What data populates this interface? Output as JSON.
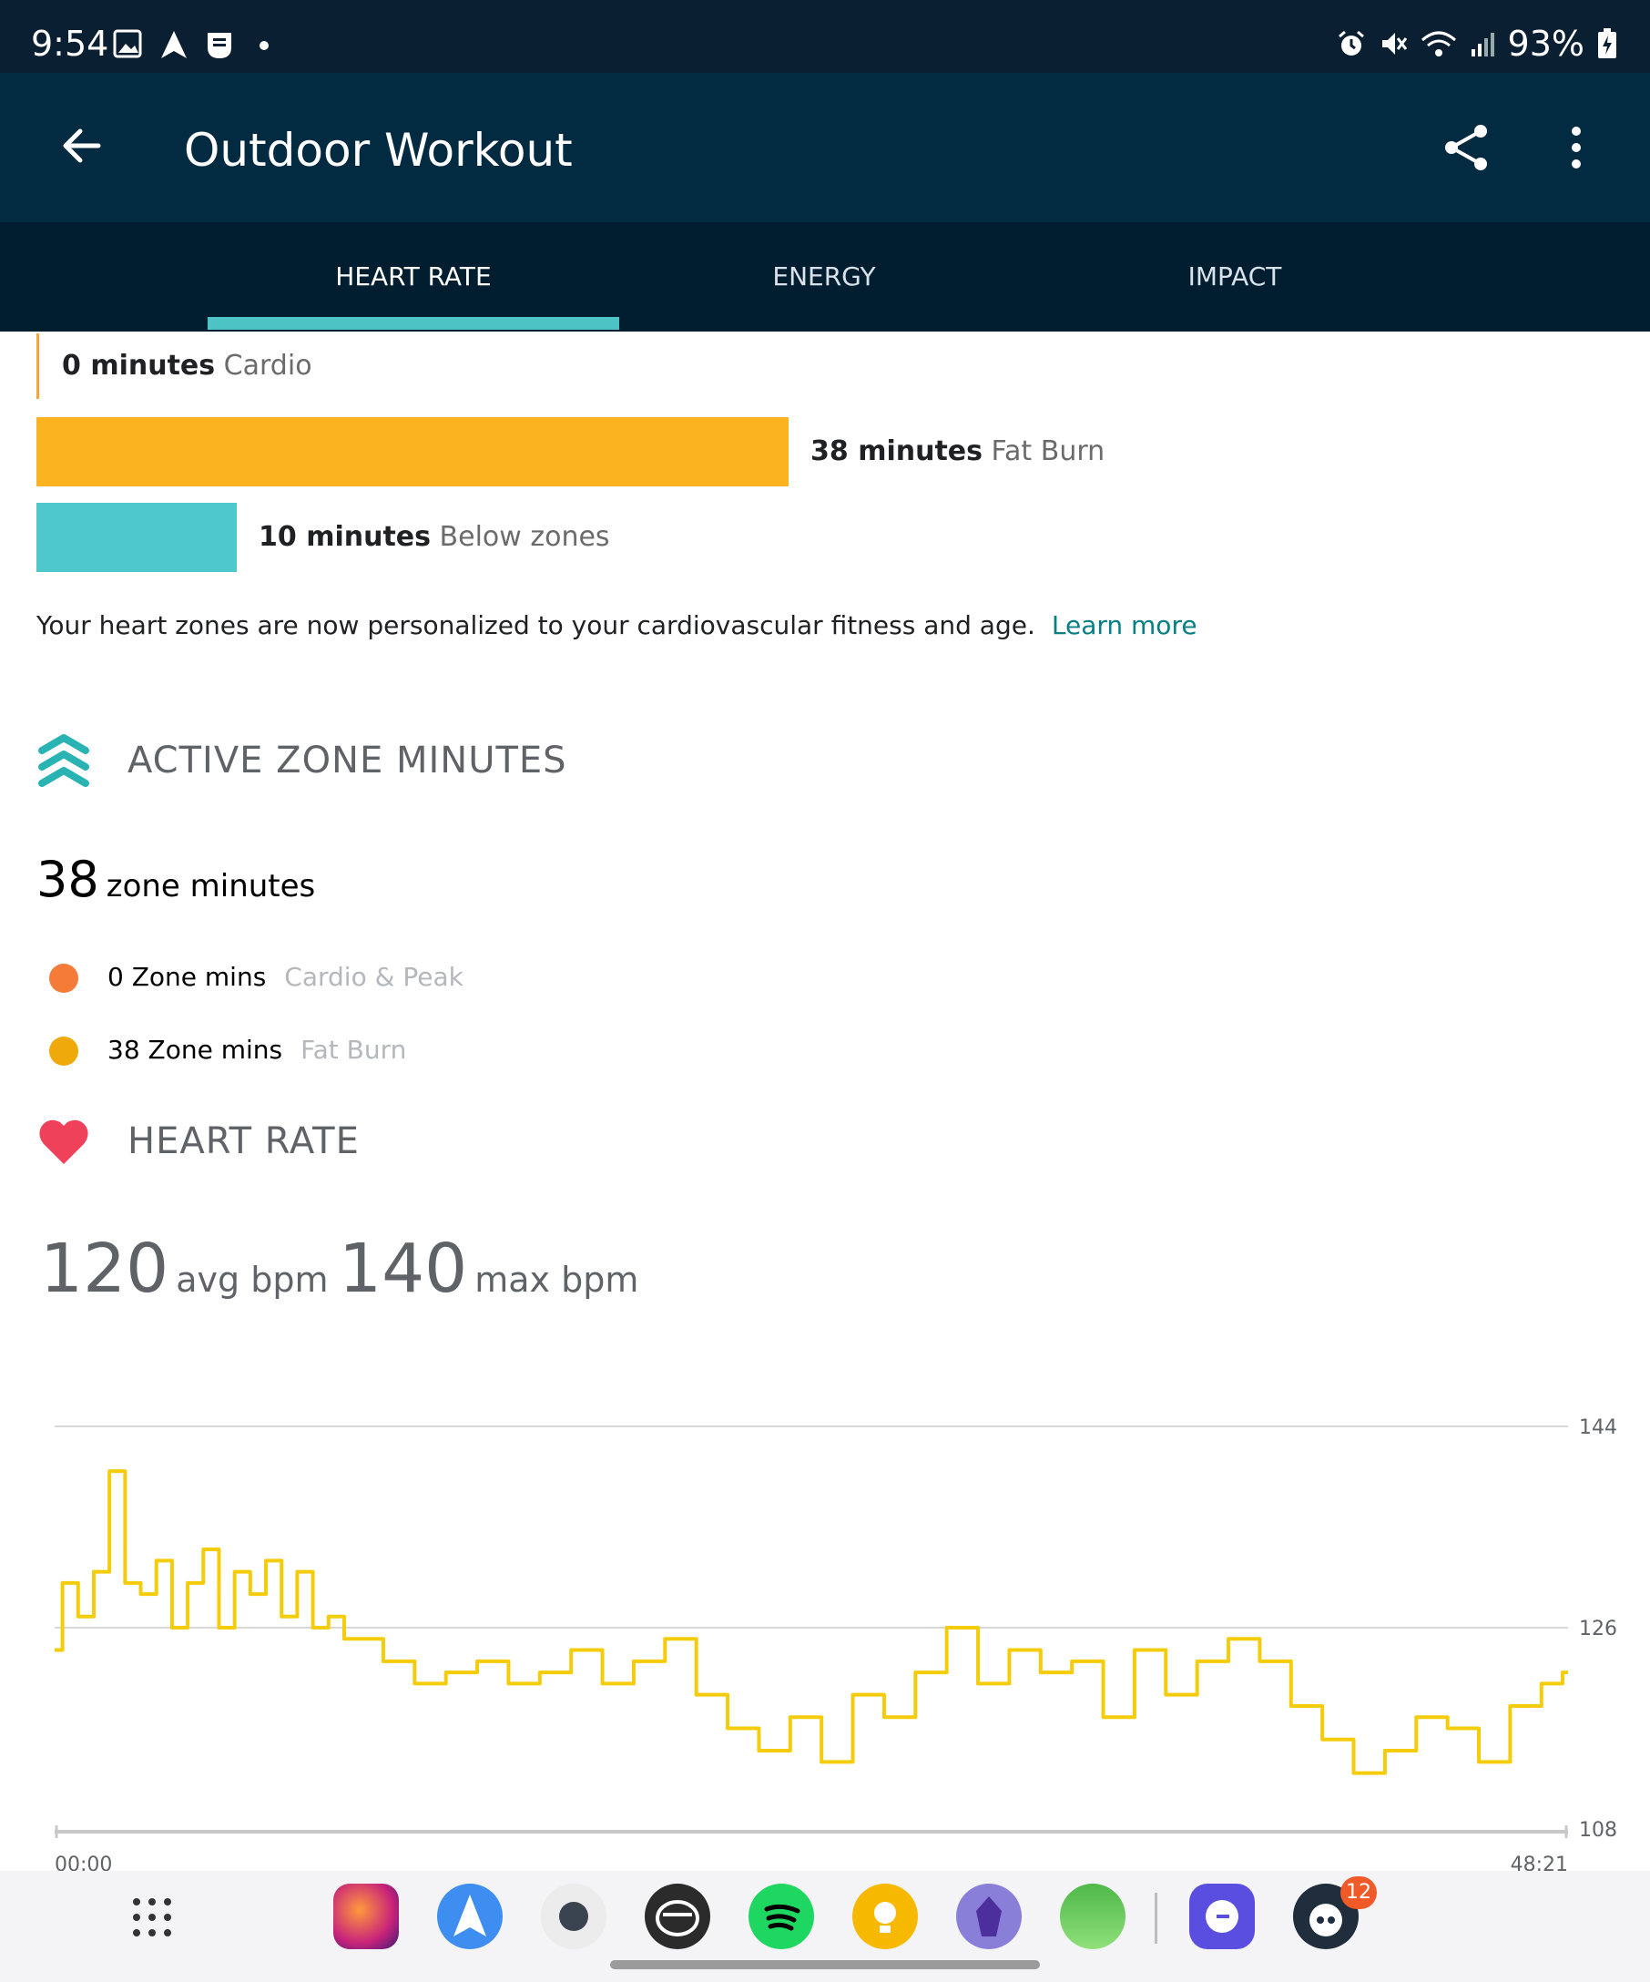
{
  "status_bar": {
    "time": "9:54",
    "battery": "93%"
  },
  "app_bar": {
    "title": "Outdoor Workout"
  },
  "tabs": [
    {
      "label": "HEART RATE",
      "selected": true
    },
    {
      "label": "ENERGY",
      "selected": false
    },
    {
      "label": "IMPACT",
      "selected": false
    }
  ],
  "zones": {
    "cardio": {
      "value": "0 minutes",
      "label": "Cardio"
    },
    "fat_burn": {
      "value": "38 minutes",
      "label": "Fat Burn"
    },
    "below": {
      "value": "10 minutes",
      "label": "Below zones"
    }
  },
  "personalized_note": "Your heart zones are now personalized to your cardiovascular fitness and age.",
  "learn_more": "Learn more",
  "azm": {
    "title": "ACTIVE ZONE MINUTES",
    "total_value": "38",
    "total_unit": "zone minutes",
    "legend": [
      {
        "value": "0 Zone mins",
        "label": "Cardio & Peak",
        "color": "#f47b38"
      },
      {
        "value": "38 Zone mins",
        "label": "Fat Burn",
        "color": "#f0a90b"
      }
    ]
  },
  "heart_rate": {
    "title": "HEART RATE",
    "avg_value": "120",
    "avg_unit": "avg bpm",
    "max_value": "140",
    "max_unit": "max bpm"
  },
  "chart_data": {
    "type": "line",
    "x_start": "00:00",
    "x_end": "48:21",
    "y_ticks": [
      144,
      126,
      108
    ],
    "ylim": [
      108,
      144
    ],
    "line_color": "#f5cc0a",
    "x_minutes": [
      0,
      0.5,
      1,
      1.5,
      2,
      2.5,
      3,
      3.5,
      4,
      4.5,
      5,
      5.5,
      6,
      6.5,
      7,
      7.5,
      8,
      8.5,
      9,
      9.5,
      10,
      11,
      12,
      13,
      14,
      15,
      16,
      17,
      18,
      19,
      20,
      21,
      22,
      23,
      24,
      25,
      26,
      27,
      28,
      29,
      30,
      31,
      32,
      33,
      34,
      35,
      36,
      37,
      38,
      39,
      40,
      41,
      42,
      43,
      44,
      45,
      46,
      47,
      48,
      48.35
    ],
    "bpm": [
      124,
      130,
      127,
      131,
      140,
      130,
      129,
      132,
      126,
      130,
      133,
      126,
      131,
      129,
      132,
      127,
      131,
      126,
      127,
      125,
      125,
      123,
      121,
      122,
      123,
      121,
      122,
      124,
      121,
      123,
      125,
      120,
      117,
      115,
      118,
      114,
      120,
      118,
      122,
      126,
      121,
      124,
      122,
      123,
      118,
      124,
      120,
      123,
      125,
      123,
      119,
      116,
      113,
      115,
      118,
      117,
      114,
      119,
      121,
      122
    ]
  },
  "dock": {
    "apps": [
      "firefox-beta",
      "spark-mail",
      "camera",
      "chef",
      "spotify",
      "keep",
      "obsidian",
      "maps",
      "signal",
      "reddit"
    ],
    "badge": "12"
  }
}
